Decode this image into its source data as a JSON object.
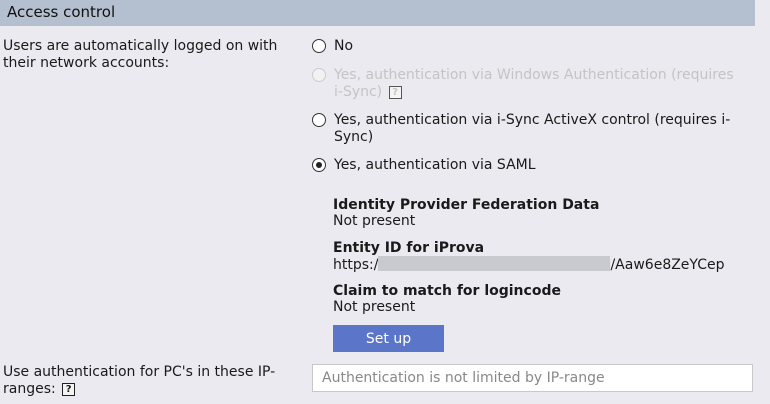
{
  "section": {
    "title": "Access control"
  },
  "auto_logon": {
    "label": "Users are automatically logged on with their network accounts:",
    "options": [
      {
        "label": "No",
        "checked": false,
        "disabled": false
      },
      {
        "label": "Yes, authentication via Windows Authentication (requires i-Sync)",
        "checked": false,
        "disabled": true,
        "help": "?"
      },
      {
        "label": "Yes, authentication via i-Sync ActiveX control (requires i-Sync)",
        "checked": false,
        "disabled": false
      },
      {
        "label": "Yes, authentication via SAML",
        "checked": true,
        "disabled": false
      }
    ]
  },
  "saml": {
    "idp_title": "Identity Provider Federation Data",
    "idp_value": "Not present",
    "entity_title": "Entity ID for iProva",
    "entity_prefix": "https:/",
    "entity_suffix": "/Aaw6e8ZeYCep",
    "claim_title": "Claim to match for logincode",
    "claim_value": "Not present",
    "setup_label": "Set up"
  },
  "ip_range": {
    "label": "Use authentication for PC's in these IP-ranges:",
    "help": "?",
    "placeholder": "Authentication is not limited by IP-range"
  }
}
